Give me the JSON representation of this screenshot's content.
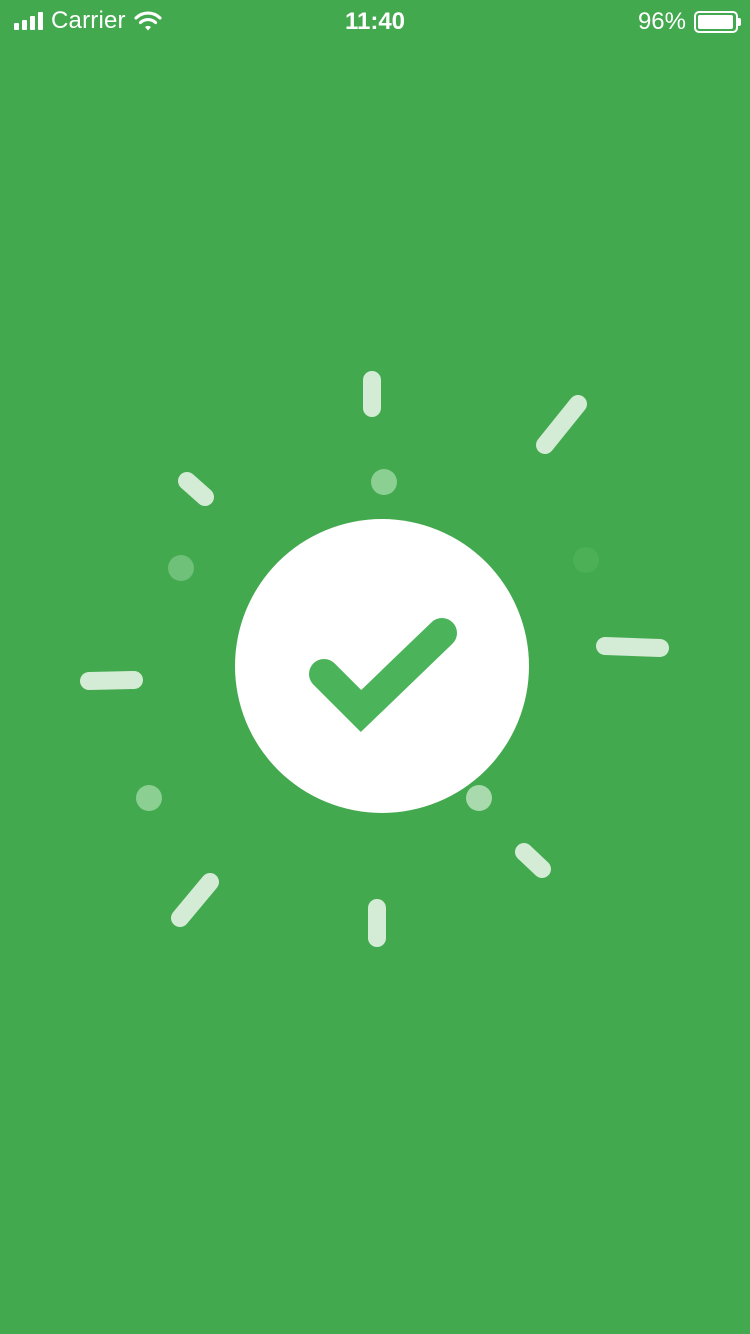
{
  "status_bar": {
    "carrier": "Carrier",
    "time": "11:40",
    "battery_text": "96%",
    "battery_level": 0.96,
    "signal_icon": "cellular-signal-icon",
    "wifi_icon": "wifi-icon",
    "battery_icon": "battery-icon"
  },
  "screen": {
    "background_color": "#43a94e",
    "circle_color": "#ffffff",
    "check_color": "#4bb45a",
    "check_icon": "checkmark-icon"
  }
}
